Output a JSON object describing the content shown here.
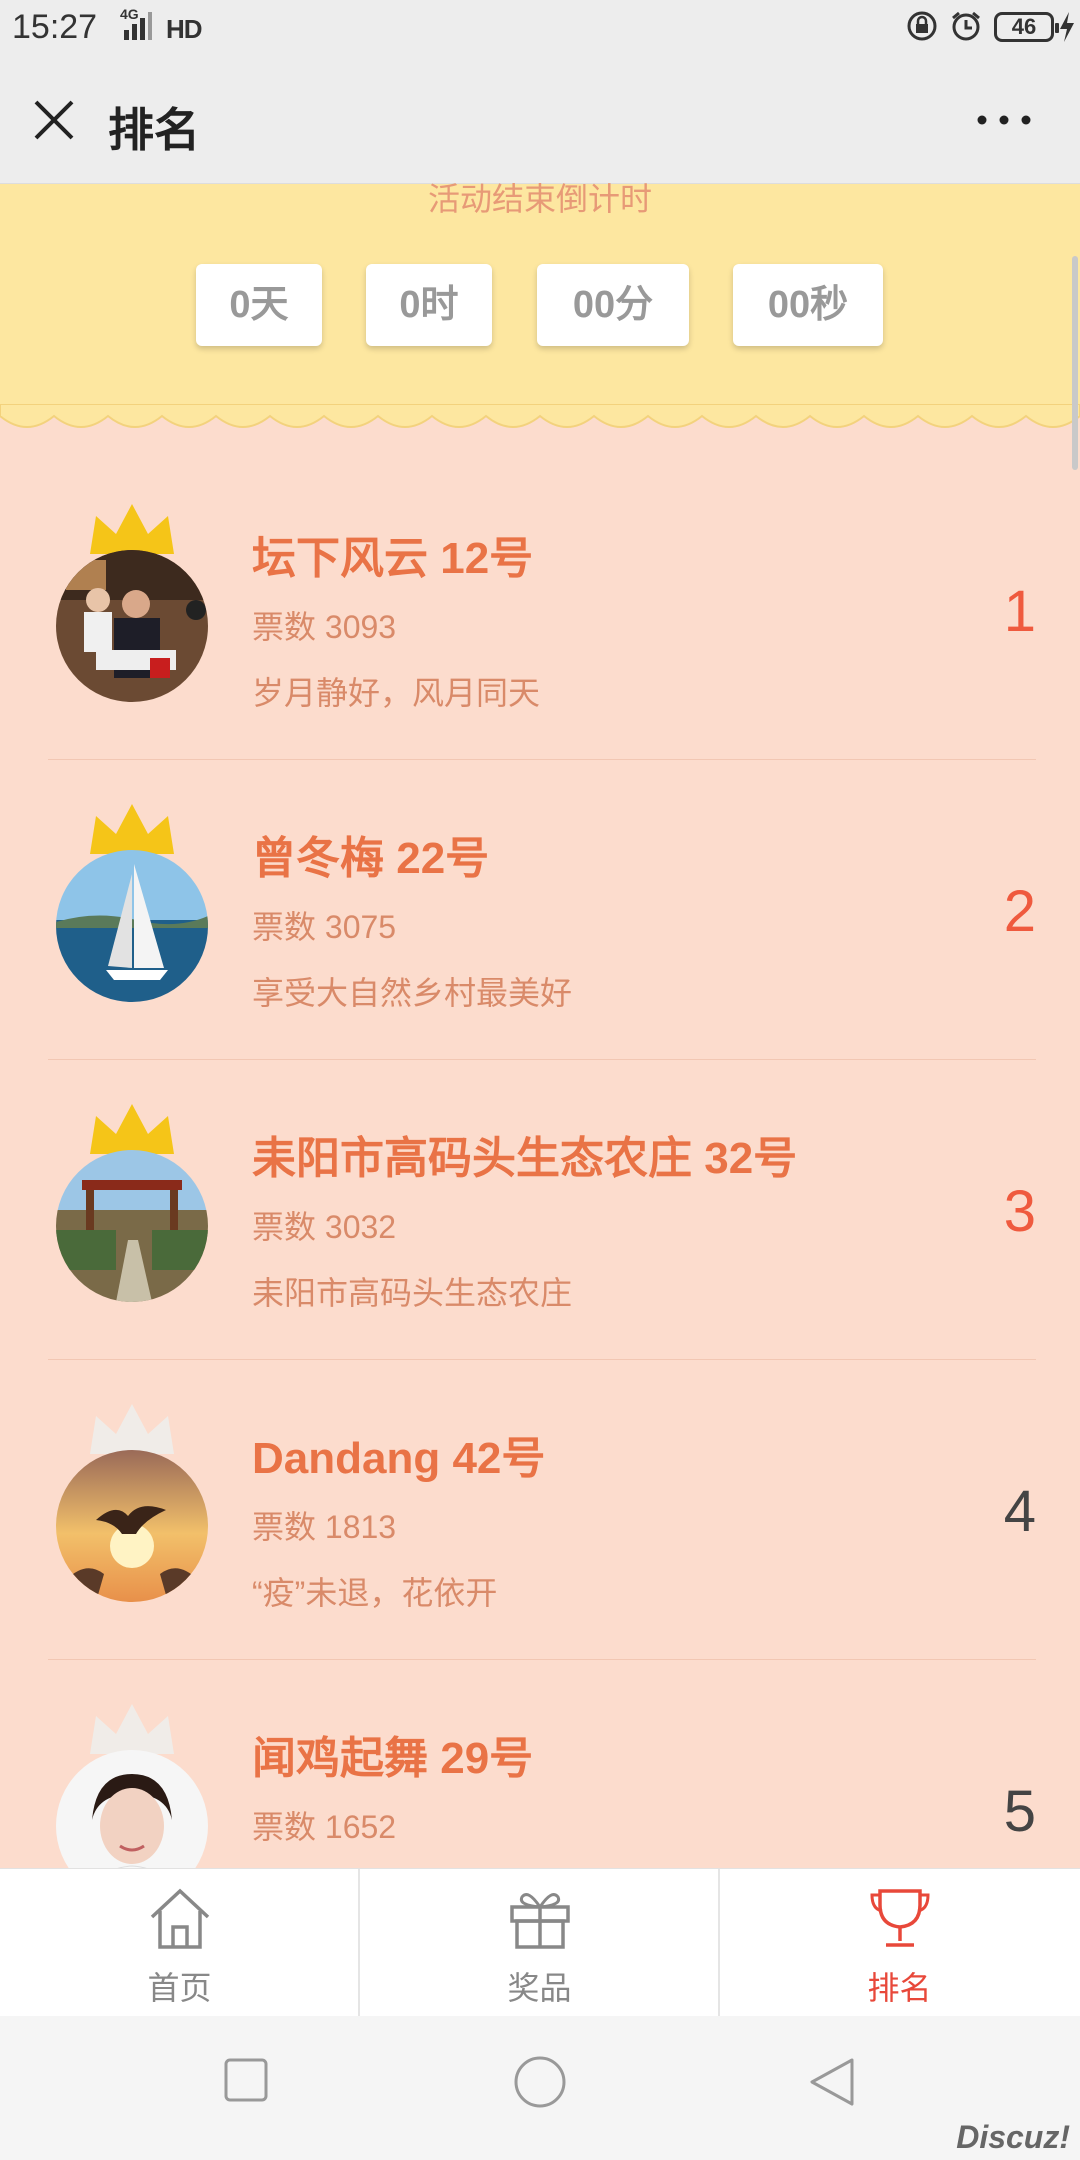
{
  "status_bar": {
    "time": "15:27",
    "network": "4G",
    "hd": "HD",
    "battery": "46"
  },
  "header": {
    "title": "排名"
  },
  "countdown": {
    "caption": "活动结束倒计时",
    "days": "0天",
    "hours": "0时",
    "minutes": "00分",
    "seconds": "00秒"
  },
  "rankings": [
    {
      "name": "坛下风云  12号",
      "votes": "票数 3093",
      "motto": "岁月静好，风月同天",
      "rank": "1",
      "crown": "#f5c518"
    },
    {
      "name": "曾冬梅  22号",
      "votes": "票数 3075",
      "motto": "享受大自然乡村最美好",
      "rank": "2",
      "crown": "#f5c518"
    },
    {
      "name": "耒阳市高码头生态农庄  32号",
      "votes": "票数 3032",
      "motto": "耒阳市高码头生态农庄",
      "rank": "3",
      "crown": "#f5c518"
    },
    {
      "name": "Dandang  42号",
      "votes": "票数 1813",
      "motto": "“疫”未退，花依开",
      "rank": "4",
      "crown": "#f0ece8"
    },
    {
      "name": "闻鸡起舞  29号",
      "votes": "票数 1652",
      "motto": "",
      "rank": "5",
      "crown": "#f0ece8"
    }
  ],
  "tabs": [
    {
      "label": "首页",
      "icon": "home-icon"
    },
    {
      "label": "奖品",
      "icon": "gift-icon"
    },
    {
      "label": "排名",
      "icon": "trophy-icon"
    }
  ],
  "watermark": "Discuz!",
  "colors": {
    "accent": "#e8483a",
    "name": "#e97346",
    "background": "#fcdccd",
    "banner": "#fde7a0"
  }
}
